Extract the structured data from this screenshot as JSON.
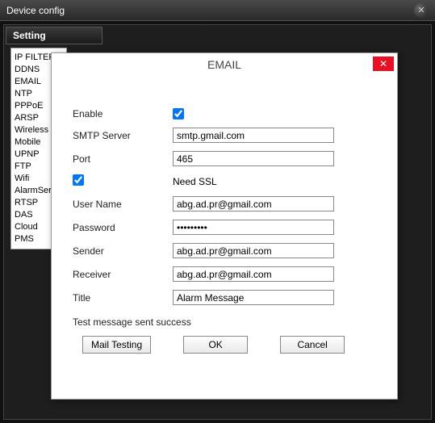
{
  "window": {
    "title": "Device config"
  },
  "sub": {
    "label": "Setting"
  },
  "sidebar": {
    "items": [
      "IP FILTER",
      "DDNS",
      "EMAIL",
      "NTP",
      "PPPoE",
      "ARSP",
      "Wireless",
      "Mobile",
      "UPNP",
      "FTP",
      "Wifi",
      "AlarmServer",
      "RTSP",
      "DAS",
      "Cloud",
      "PMS"
    ]
  },
  "dialog": {
    "title": "EMAIL",
    "fields": {
      "enable_label": "Enable",
      "enable_checked": true,
      "smtp_label": "SMTP Server",
      "smtp_value": "smtp.gmail.com",
      "port_label": "Port",
      "port_value": "465",
      "ssl_checked": true,
      "ssl_label": "Need SSL",
      "user_label": "User Name",
      "user_value": "abg.ad.pr@gmail.com",
      "pass_label": "Password",
      "pass_value": "•••••••••",
      "sender_label": "Sender",
      "sender_value": "abg.ad.pr@gmail.com",
      "receiver_label": "Receiver",
      "receiver_value": "abg.ad.pr@gmail.com",
      "title_label": "Title",
      "title_value": "Alarm Message"
    },
    "status": "Test message sent success",
    "buttons": {
      "test": "Mail Testing",
      "ok": "OK",
      "cancel": "Cancel"
    }
  }
}
